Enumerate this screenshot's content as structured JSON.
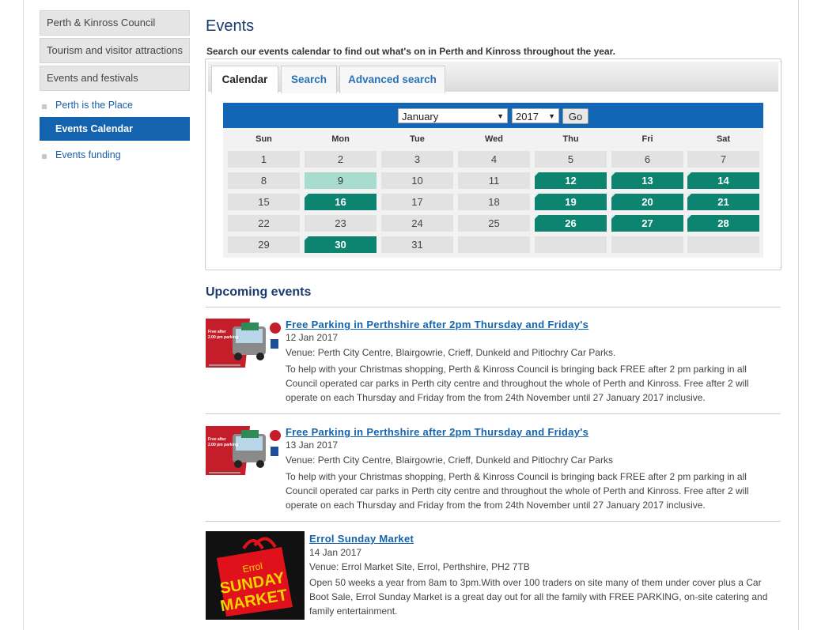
{
  "sidebar": {
    "top_items": [
      "Perth & Kinross Council",
      "Tourism and visitor attractions",
      "Events and festivals"
    ],
    "sub_items": [
      "Perth is the Place",
      "Events Calendar",
      "Events funding"
    ]
  },
  "main": {
    "title": "Events",
    "intro": "Search our events calendar to find out what's on in Perth and Kinross throughout the year.",
    "tabs": [
      "Calendar",
      "Search",
      "Advanced search"
    ],
    "month_select": "January",
    "year_select": "2017",
    "go_label": "Go",
    "weekdays": [
      "Sun",
      "Mon",
      "Tue",
      "Wed",
      "Thu",
      "Fri",
      "Sat"
    ],
    "days": [
      "1",
      "2",
      "3",
      "4",
      "5",
      "6",
      "7",
      "8",
      "9",
      "10",
      "11",
      "12",
      "13",
      "14",
      "15",
      "16",
      "17",
      "18",
      "19",
      "20",
      "21",
      "22",
      "23",
      "24",
      "25",
      "26",
      "27",
      "28",
      "29",
      "30",
      "31"
    ],
    "event_days": [
      "12",
      "13",
      "14",
      "16",
      "19",
      "20",
      "21",
      "26",
      "27",
      "28",
      "30"
    ],
    "today_day": "9",
    "upcoming_title": "Upcoming events",
    "events": [
      {
        "title": "Free Parking in Perthshire after 2pm Thursday and Friday's",
        "date": "12 Jan 2017",
        "venue": "Venue: Perth City Centre, Blairgowrie, Crieff, Dunkeld and Pitlochry Car Parks.",
        "desc": "To help with your Christmas shopping, Perth & Kinross Council is bringing back FREE after 2 pm parking in all Council operated car parks in Perth city centre and throughout the whole of Perth and Kinross. Free after 2 will operate on each Thursday and Friday from the from 24th November until 27 January 2017 inclusive."
      },
      {
        "title": "Free Parking in Perthshire after 2pm Thursday and Friday's",
        "date": "13 Jan 2017",
        "venue": "Venue: Perth City Centre, Blairgowrie, Crieff, Dunkeld and Pitlochry Car Parks",
        "desc": "To help with your Christmas shopping, Perth & Kinross Council is bringing back FREE after 2 pm parking in all Council operated car parks in Perth city centre and throughout the whole of Perth and Kinross. Free after 2 will operate on each Thursday and Friday from the from 24th November until 27 January 2017 inclusive."
      },
      {
        "title": "Errol Sunday Market",
        "date": "14 Jan 2017",
        "venue": "Venue: Errol Market Site, Errol, Perthshire, PH2 7TB",
        "desc": "Open 50 weeks a year from 8am to 3pm.With over 100 traders on site many of them under cover plus a Car Boot Sale, Errol Sunday Market is a great day out for all the family with FREE PARKING, on-site catering and family entertainment."
      }
    ],
    "parking_thumb_text": "Free after 2.00 pm parking",
    "market_logo_text": [
      "Errol",
      "SUNDAY",
      "MARKET"
    ]
  }
}
